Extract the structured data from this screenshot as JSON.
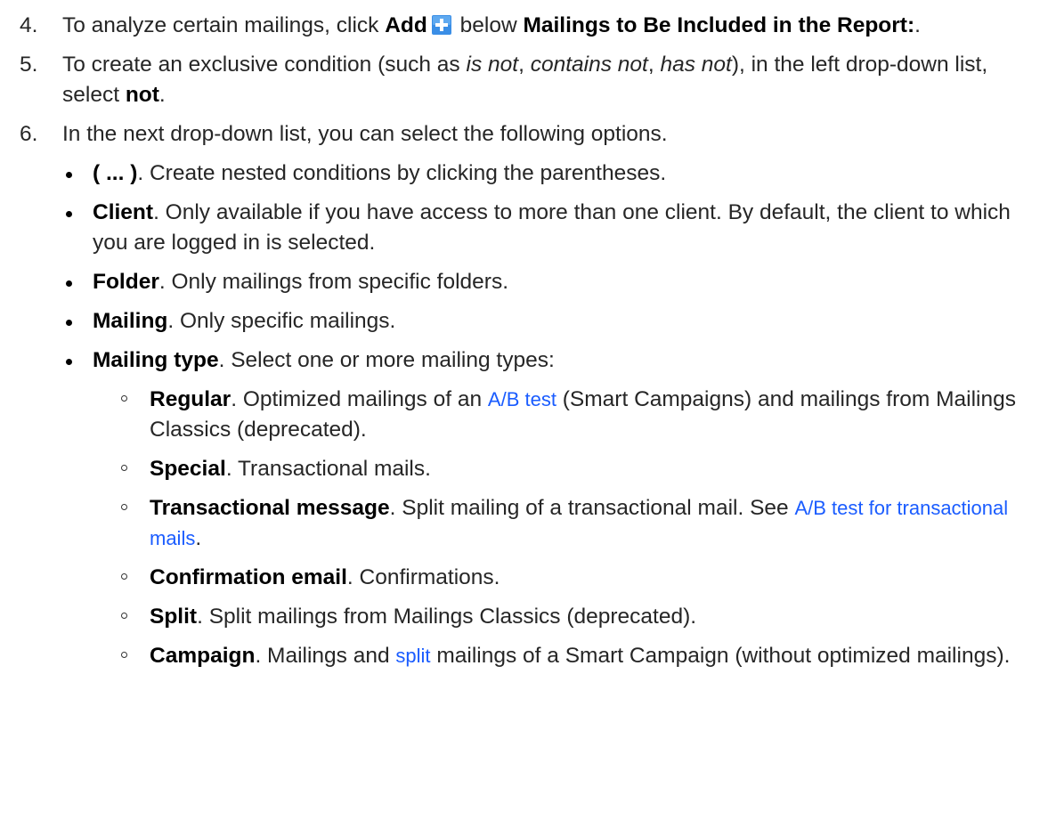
{
  "step4": {
    "number": "4.",
    "text_before": "To analyze certain mailings, click ",
    "add_label": "Add",
    "text_middle": " below ",
    "target_label": "Mailings to Be Included in the Report:",
    "text_after": "."
  },
  "step5": {
    "number": "5.",
    "text_before": "To create an exclusive condition (such as ",
    "ex1": "is not",
    "sep1": ", ",
    "ex2": "contains not",
    "sep2": ", ",
    "ex3": "has not",
    "text_middle": "), in the left drop-down list, select ",
    "option": "not",
    "text_after": "."
  },
  "step6": {
    "number": "6.",
    "text": "In the next drop-down list, you can select the following options.",
    "bullets": [
      {
        "term": "( ... )",
        "desc": ". Create nested conditions by clicking the parentheses."
      },
      {
        "term": "Client",
        "desc": ". Only available if you have access to more than one client. By default, the client to which you are logged in is selected."
      },
      {
        "term": "Folder",
        "desc": ". Only mailings from specific folders."
      },
      {
        "term": "Mailing",
        "desc": ". Only specific mailings."
      },
      {
        "term": "Mailing type",
        "desc": ". Select one or more mailing types:"
      }
    ],
    "mailing_types": {
      "regular": {
        "term": "Regular",
        "desc_before": ". Optimized mailings of an ",
        "link": "A/B test",
        "desc_after": " (Smart Campaigns) and mailings from Mailings Classics (deprecated)."
      },
      "special": {
        "term": "Special",
        "desc": ". Transactional mails."
      },
      "transactional": {
        "term": "Transactional message",
        "desc_before": ". Split mailing of a transactional mail. See ",
        "link": "A/B test for transactional mails",
        "desc_after": "."
      },
      "confirmation": {
        "term": "Confirmation email",
        "desc": ". Confirmations."
      },
      "split": {
        "term": "Split",
        "desc": ". Split mailings from Mailings Classics (deprecated)."
      },
      "campaign": {
        "term": "Campaign",
        "desc_before": ". Mailings and ",
        "link": "split",
        "desc_after": " mailings of a Smart Campaign (without optimized mailings)."
      }
    }
  },
  "icons": {
    "add_icon": "add-plus-icon",
    "add_icon_color": "#3a8ee6"
  }
}
